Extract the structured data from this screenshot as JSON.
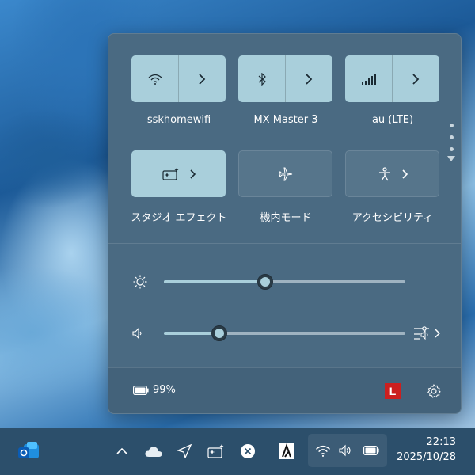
{
  "quick_settings": {
    "tiles": [
      {
        "label": "sskhomewifi",
        "icon": "wifi-icon",
        "state": "on",
        "has_chevron": true
      },
      {
        "label": "MX Master 3",
        "icon": "bluetooth-icon",
        "state": "on",
        "has_chevron": true
      },
      {
        "label": "au (LTE)",
        "icon": "cellular-icon",
        "state": "on",
        "has_chevron": true
      },
      {
        "label": "スタジオ エフェクト",
        "icon": "studio-effects-icon",
        "state": "on",
        "has_chevron": true
      },
      {
        "label": "機内モード",
        "icon": "airplane-icon",
        "state": "off",
        "has_chevron": false
      },
      {
        "label": "アクセシビリティ",
        "icon": "accessibility-icon",
        "state": "off",
        "has_chevron": true
      }
    ],
    "brightness": {
      "icon": "brightness-icon",
      "value_fraction": 0.42
    },
    "volume": {
      "icon": "speaker-icon",
      "value_fraction": 0.23
    },
    "battery": {
      "icon": "battery-icon",
      "label": "99%"
    },
    "footer_app_badge": "L"
  },
  "taskbar": {
    "clock_time": "22:13",
    "clock_date": "2025/10/28"
  },
  "colors": {
    "panel_bg": "#4a6a82",
    "tile_on": "#a9cfdb",
    "taskbar_bg": "#2c4f6b",
    "app_badge_red": "#cc1f1f"
  }
}
